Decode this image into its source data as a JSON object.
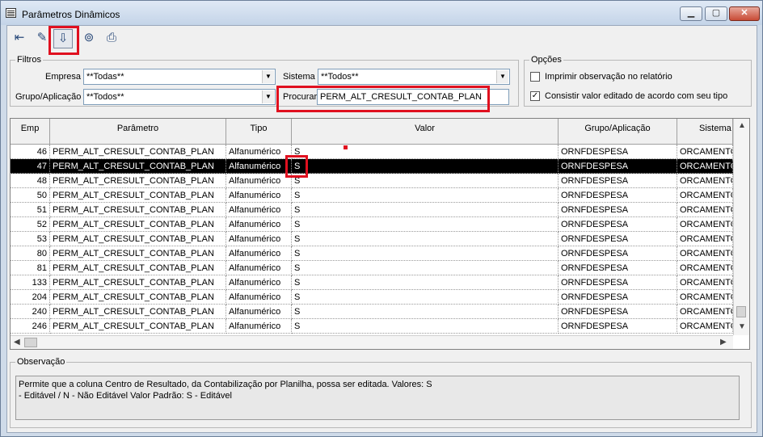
{
  "window": {
    "title": "Parâmetros Dinâmicos",
    "min_label": "▭",
    "max_label": "□",
    "close_label": "✕"
  },
  "filtros": {
    "legend": "Filtros",
    "empresa_label": "Empresa",
    "empresa_value": "**Todas**",
    "sistema_label": "Sistema",
    "sistema_value": "**Todos**",
    "grupo_label": "Grupo/Aplicação",
    "grupo_value": "**Todos**",
    "procurar_label": "Procurar",
    "procurar_value": "PERM_ALT_CRESULT_CONTAB_PLAN"
  },
  "opcoes": {
    "legend": "Opções",
    "imprimir_label": "Imprimir observação no relatório",
    "imprimir_checked": false,
    "consistir_label": "Consistir valor editado de acordo com seu tipo",
    "consistir_checked": true
  },
  "grid": {
    "headers": [
      "Emp",
      "Parâmetro",
      "Tipo",
      "Valor",
      "Grupo/Aplicação",
      "Sistema"
    ],
    "rows": [
      {
        "emp": "46",
        "param": "PERM_ALT_CRESULT_CONTAB_PLAN",
        "tipo": "Alfanumérico",
        "valor": "S",
        "grupo": "ORNFDESPESA",
        "sistema": "ORCAMENTO"
      },
      {
        "emp": "47",
        "param": "PERM_ALT_CRESULT_CONTAB_PLAN",
        "tipo": "Alfanumérico",
        "valor": "S",
        "grupo": "ORNFDESPESA",
        "sistema": "ORCAMENTO"
      },
      {
        "emp": "48",
        "param": "PERM_ALT_CRESULT_CONTAB_PLAN",
        "tipo": "Alfanumérico",
        "valor": "S",
        "grupo": "ORNFDESPESA",
        "sistema": "ORCAMENTO"
      },
      {
        "emp": "50",
        "param": "PERM_ALT_CRESULT_CONTAB_PLAN",
        "tipo": "Alfanumérico",
        "valor": "S",
        "grupo": "ORNFDESPESA",
        "sistema": "ORCAMENTO"
      },
      {
        "emp": "51",
        "param": "PERM_ALT_CRESULT_CONTAB_PLAN",
        "tipo": "Alfanumérico",
        "valor": "S",
        "grupo": "ORNFDESPESA",
        "sistema": "ORCAMENTO"
      },
      {
        "emp": "52",
        "param": "PERM_ALT_CRESULT_CONTAB_PLAN",
        "tipo": "Alfanumérico",
        "valor": "S",
        "grupo": "ORNFDESPESA",
        "sistema": "ORCAMENTO"
      },
      {
        "emp": "53",
        "param": "PERM_ALT_CRESULT_CONTAB_PLAN",
        "tipo": "Alfanumérico",
        "valor": "S",
        "grupo": "ORNFDESPESA",
        "sistema": "ORCAMENTO"
      },
      {
        "emp": "80",
        "param": "PERM_ALT_CRESULT_CONTAB_PLAN",
        "tipo": "Alfanumérico",
        "valor": "S",
        "grupo": "ORNFDESPESA",
        "sistema": "ORCAMENTO"
      },
      {
        "emp": "81",
        "param": "PERM_ALT_CRESULT_CONTAB_PLAN",
        "tipo": "Alfanumérico",
        "valor": "S",
        "grupo": "ORNFDESPESA",
        "sistema": "ORCAMENTO"
      },
      {
        "emp": "133",
        "param": "PERM_ALT_CRESULT_CONTAB_PLAN",
        "tipo": "Alfanumérico",
        "valor": "S",
        "grupo": "ORNFDESPESA",
        "sistema": "ORCAMENTO"
      },
      {
        "emp": "204",
        "param": "PERM_ALT_CRESULT_CONTAB_PLAN",
        "tipo": "Alfanumérico",
        "valor": "S",
        "grupo": "ORNFDESPESA",
        "sistema": "ORCAMENTO"
      },
      {
        "emp": "240",
        "param": "PERM_ALT_CRESULT_CONTAB_PLAN",
        "tipo": "Alfanumérico",
        "valor": "S",
        "grupo": "ORNFDESPESA",
        "sistema": "ORCAMENTO"
      },
      {
        "emp": "246",
        "param": "PERM_ALT_CRESULT_CONTAB_PLAN",
        "tipo": "Alfanumérico",
        "valor": "S",
        "grupo": "ORNFDESPESA",
        "sistema": "ORCAMENTO"
      }
    ],
    "selected_emp": "47"
  },
  "observacao": {
    "legend": "Observação",
    "line1": "Permite que a coluna Centro de Resultado, da Contabilização por Planilha, possa ser editada. Valores: S",
    "line2": "- Editável / N - Não Editável Valor Padrão: S - Editável"
  },
  "colors": {
    "highlight": "#e0101f",
    "selection": "#000000"
  }
}
